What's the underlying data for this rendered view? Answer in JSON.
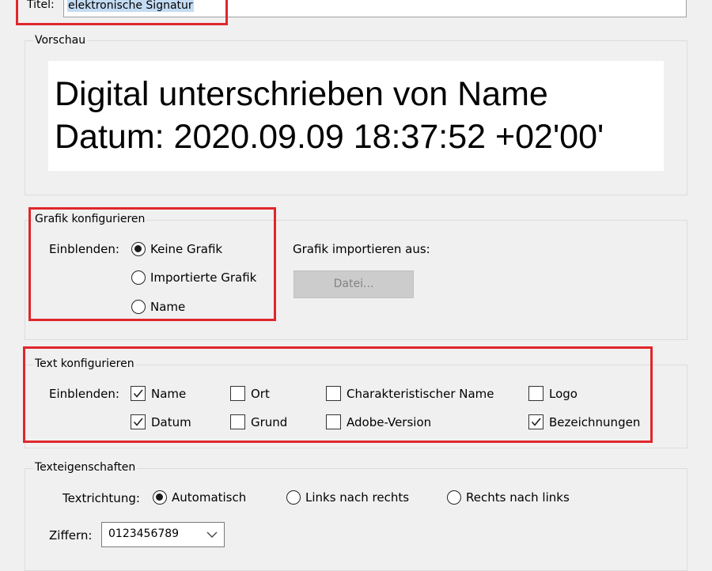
{
  "title_field": {
    "label": "Titel:",
    "value": "elektronische Signatur"
  },
  "preview": {
    "group_label": "Vorschau",
    "line1": "Digital unterschrieben von Name",
    "line2": "Datum: 2020.09.09 18:37:52 +02'00'"
  },
  "graphic": {
    "group_label": "Grafik konfigurieren",
    "show_label": "Einblenden:",
    "options": [
      {
        "label": "Keine Grafik",
        "checked": true
      },
      {
        "label": "Importierte Grafik",
        "checked": false
      },
      {
        "label": "Name",
        "checked": false
      }
    ],
    "import_label": "Grafik importieren aus:",
    "file_button": "Datei..."
  },
  "text_config": {
    "group_label": "Text konfigurieren",
    "show_label": "Einblenden:",
    "items": [
      {
        "label": "Name",
        "checked": true
      },
      {
        "label": "Ort",
        "checked": false
      },
      {
        "label": "Charakteristischer Name",
        "checked": false
      },
      {
        "label": "Logo",
        "checked": false
      },
      {
        "label": "Datum",
        "checked": true
      },
      {
        "label": "Grund",
        "checked": false
      },
      {
        "label": "Adobe-Version",
        "checked": false
      },
      {
        "label": "Bezeichnungen",
        "checked": true
      }
    ]
  },
  "text_props": {
    "group_label": "Texteigenschaften",
    "direction_label": "Textrichtung:",
    "directions": [
      {
        "label": "Automatisch",
        "checked": true
      },
      {
        "label": "Links nach rechts",
        "checked": false
      },
      {
        "label": "Rechts nach links",
        "checked": false
      }
    ],
    "digits_label": "Ziffern:",
    "digits_value": "0123456789"
  },
  "colors": {
    "highlight_border": "#e0262c",
    "selection": "#c4dcf3"
  }
}
